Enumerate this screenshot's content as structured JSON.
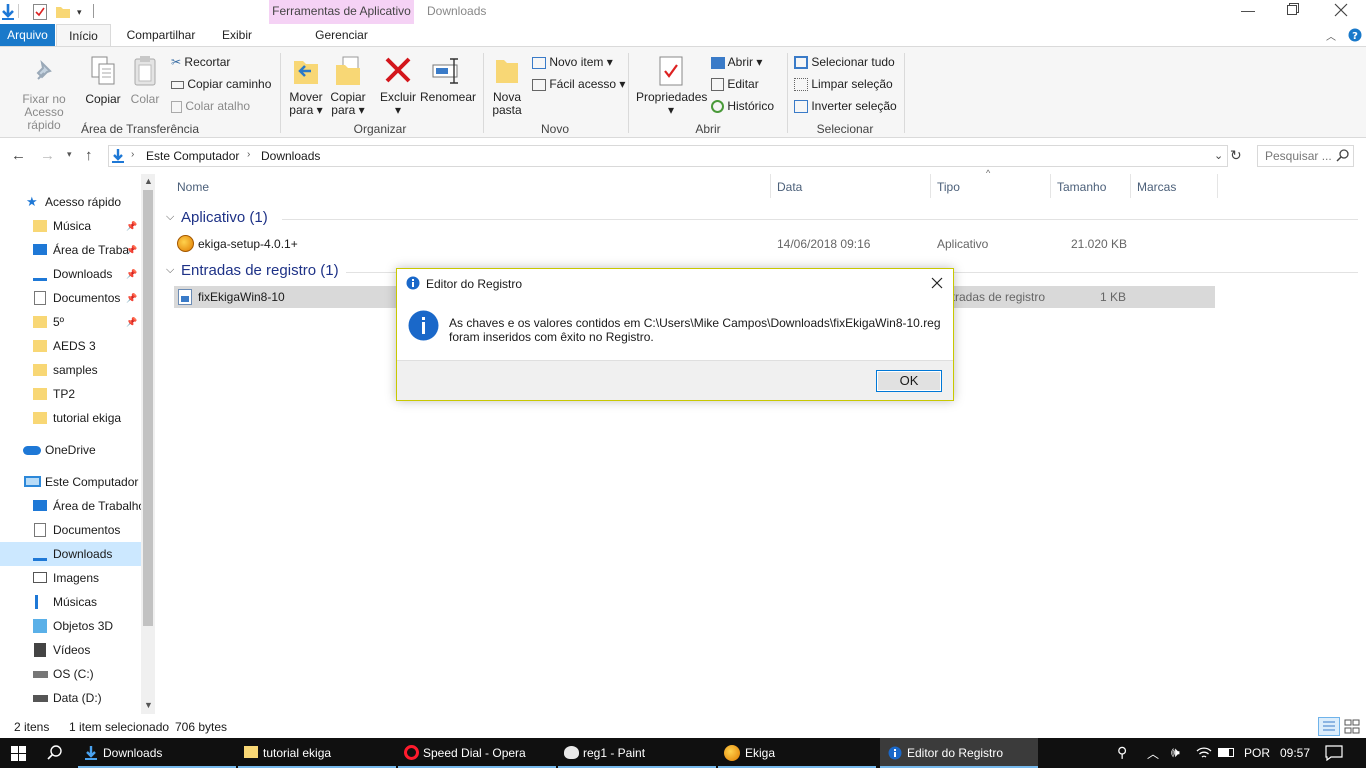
{
  "window": {
    "title": "Downloads",
    "context_tab": "Ferramentas de Aplicativo"
  },
  "ribbon_tabs": {
    "file": "Arquivo",
    "home": "Início",
    "share": "Compartilhar",
    "view": "Exibir",
    "manage": "Gerenciar"
  },
  "clipboard": {
    "pin_l1": "Fixar no",
    "pin_l2": "Acesso rápido",
    "copy": "Copiar",
    "paste": "Colar",
    "cut": "Recortar",
    "copy_path": "Copiar caminho",
    "paste_shortcut": "Colar atalho",
    "group": "Área de Transferência"
  },
  "organize": {
    "move_l1": "Mover",
    "move_l2": "para",
    "copyto_l1": "Copiar",
    "copyto_l2": "para",
    "delete": "Excluir",
    "rename": "Renomear",
    "group": "Organizar"
  },
  "new": {
    "folder_l1": "Nova",
    "folder_l2": "pasta",
    "item": "Novo item",
    "easy": "Fácil acesso",
    "group": "Novo"
  },
  "open": {
    "props": "Propriedades",
    "open": "Abrir",
    "edit": "Editar",
    "history": "Histórico",
    "group": "Abrir"
  },
  "select": {
    "all": "Selecionar tudo",
    "none": "Limpar seleção",
    "invert": "Inverter seleção",
    "group": "Selecionar"
  },
  "address": {
    "crumb1": "Este Computador",
    "crumb2": "Downloads",
    "search_placeholder": "Pesquisar ..."
  },
  "nav": {
    "quick": "Acesso rápido",
    "items": [
      "Música",
      "Área de Traba",
      "Downloads",
      "Documentos",
      "5º",
      "AEDS 3",
      "samples",
      "TP2",
      "tutorial ekiga"
    ],
    "onedrive": "OneDrive",
    "pc": "Este Computador",
    "pc_items": [
      "Área de Trabalho",
      "Documentos",
      "Downloads",
      "Imagens",
      "Músicas",
      "Objetos 3D",
      "Vídeos",
      "OS (C:)",
      "Data (D:)"
    ]
  },
  "columns": {
    "name": "Nome",
    "date": "Data",
    "type": "Tipo",
    "size": "Tamanho",
    "tags": "Marcas"
  },
  "groups": [
    {
      "header": "Aplicativo (1)",
      "file": {
        "name": "ekiga-setup-4.0.1+",
        "date": "14/06/2018 09:16",
        "type": "Aplicativo",
        "size": "21.020 KB"
      }
    },
    {
      "header": "Entradas de registro (1)",
      "file": {
        "name": "fixEkigaWin8-10",
        "date": "",
        "type": "Entradas de registro",
        "size": "1 KB"
      }
    }
  ],
  "status": {
    "count": "2 itens",
    "selected": "1 item selecionado",
    "bytes": "706 bytes"
  },
  "dialog": {
    "title": "Editor do Registro",
    "line1": "As chaves e os valores contidos em C:\\Users\\Mike Campos\\Downloads\\fixEkigaWin8-10.reg",
    "line2": "foram inseridos com êxito no Registro.",
    "ok": "OK"
  },
  "taskbar": {
    "items": [
      "Downloads",
      "tutorial ekiga",
      "Speed Dial - Opera",
      "reg1 - Paint",
      "Ekiga",
      "Editor do Registro"
    ],
    "lang": "POR",
    "time": "09:57"
  },
  "colors": {
    "accent": "#0078d7",
    "context_tab": "#f5d2f5",
    "selection": "#cce8ff",
    "group_header": "#1e3287",
    "taskbar": "#101010"
  }
}
